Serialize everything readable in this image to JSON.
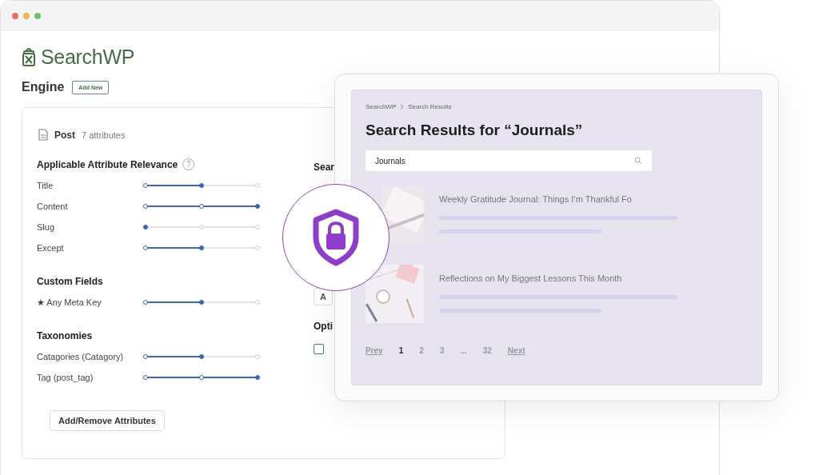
{
  "brand": {
    "name": "SearchWP"
  },
  "engine": {
    "title": "Engine",
    "add_button": "Add New"
  },
  "post": {
    "title": "Post",
    "count": "7 attributes"
  },
  "sections": [
    {
      "heading": "Applicable Attribute Relevance",
      "help": "?",
      "attributes": [
        {
          "label": "Title",
          "level": 0.5
        },
        {
          "label": "Content",
          "level": 1
        },
        {
          "label": "Slug",
          "level": 0
        },
        {
          "label": "Except",
          "level": 0.5
        }
      ]
    },
    {
      "heading": "Custom Fields",
      "attributes": [
        {
          "label": "★ Any Meta Key",
          "level": 0.5
        }
      ]
    },
    {
      "heading": "Taxonomies",
      "attributes": [
        {
          "label": "Catagories (Catagory)",
          "level": 0.5
        },
        {
          "label": "Tag (post_tag)",
          "level": 1
        }
      ]
    }
  ],
  "add_remove_button": "Add/Remove Attributes",
  "right_column": {
    "search_heading": "Sear",
    "add_button": "A",
    "options_heading": "Opti",
    "checkbox": {
      "checked": false
    }
  },
  "preview": {
    "breadcrumb": [
      "SearchWP",
      "Search Results"
    ],
    "heading": "Search Results for “Journals”",
    "search": {
      "value": "Journals"
    },
    "results": [
      {
        "title": "Weekly Gratitude Journal: Things I’m Thankful Fo"
      },
      {
        "title": "Reflections on My Biggest Lessons This Month"
      }
    ],
    "pagination": [
      {
        "label": "Prev",
        "kind": "link",
        "selected": false
      },
      {
        "label": "1",
        "kind": "page",
        "selected": true
      },
      {
        "label": "2",
        "kind": "page",
        "selected": false
      },
      {
        "label": "3",
        "kind": "page",
        "selected": false
      },
      {
        "label": "...",
        "kind": "page",
        "selected": false
      },
      {
        "label": "32",
        "kind": "page",
        "selected": false
      },
      {
        "label": "Next",
        "kind": "link",
        "selected": false
      }
    ]
  }
}
